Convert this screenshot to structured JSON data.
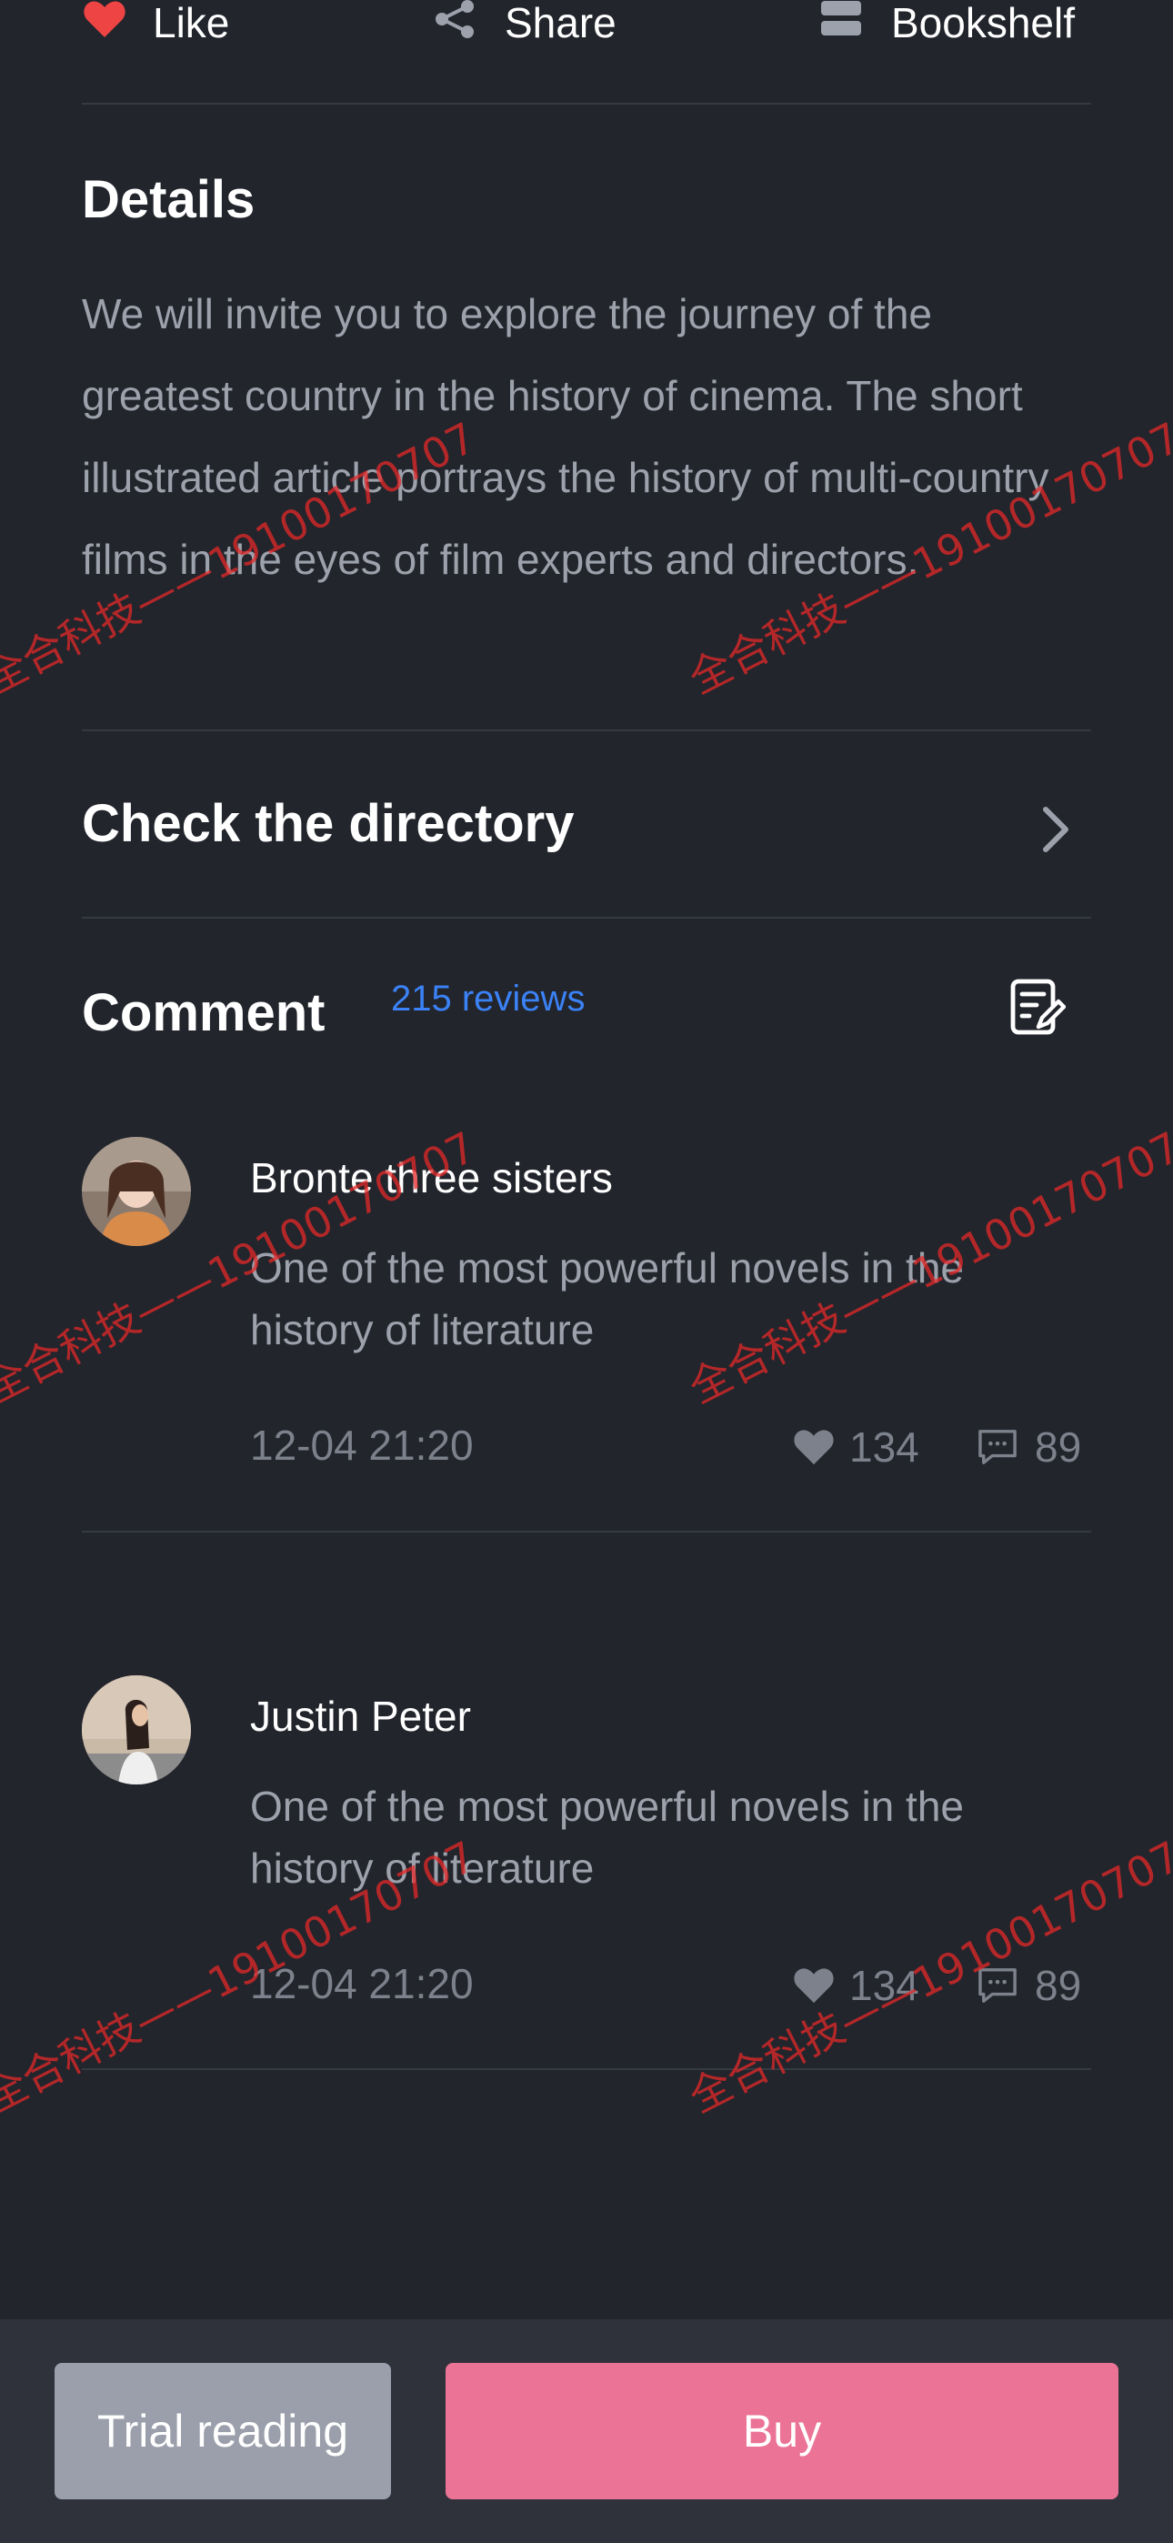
{
  "actions": {
    "like_label": "Like",
    "share_label": "Share",
    "bookshelf_label": "Bookshelf"
  },
  "details": {
    "title": "Details",
    "body": "We will invite you to explore the journey of the greatest country in the history of cinema. The short illustrated article portrays the history of multi-country films in the eyes of film experts and directors."
  },
  "directory": {
    "title": "Check the directory"
  },
  "comments": {
    "title": "Comment",
    "reviews_link": "215 reviews",
    "items": [
      {
        "name": "Bronte three sisters",
        "text": "One of the most powerful novels in the history of literature",
        "time": "12-04 21:20",
        "likes": "134",
        "replies": "89"
      },
      {
        "name": "Justin Peter",
        "text": "One of the most powerful novels in the history of literature",
        "time": "12-04 21:20",
        "likes": "134",
        "replies": "89"
      }
    ]
  },
  "footer": {
    "trial_label": "Trial reading",
    "buy_label": "Buy"
  },
  "watermark": {
    "text": "全合科技——19100170707"
  },
  "colors": {
    "background": "#22252c",
    "accent_blue": "#3b82f6",
    "buy_pink": "#eb7396",
    "trial_gray": "#9a9fab",
    "like_red": "#ef4444"
  }
}
